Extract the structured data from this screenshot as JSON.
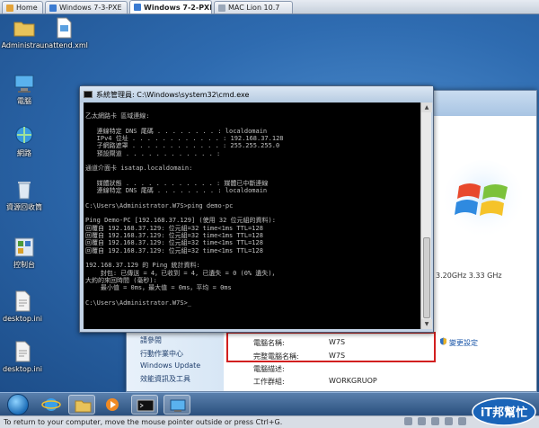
{
  "tabs": [
    {
      "label": "Home",
      "active": false
    },
    {
      "label": "Windows 7-3-PXE",
      "active": false
    },
    {
      "label": "Windows 7-2-PXE",
      "active": true
    },
    {
      "label": "MAC Lion 10.7",
      "active": false
    }
  ],
  "desktop_icons": [
    {
      "label": "Administra...",
      "icon": "folder-icon"
    },
    {
      "label": "unattend.xml",
      "icon": "xml-file-icon"
    },
    {
      "label": "電腦",
      "icon": "computer-icon"
    },
    {
      "label": "網路",
      "icon": "network-icon"
    },
    {
      "label": "資源回收筒",
      "icon": "recycle-bin-icon"
    },
    {
      "label": "控制台",
      "icon": "control-panel-icon"
    },
    {
      "label": "desktop.ini",
      "icon": "ini-file-icon"
    },
    {
      "label": "desktop.ini",
      "icon": "ini-file-icon"
    }
  ],
  "cmd": {
    "title": "系統管理員: C:\\Windows\\system32\\cmd.exe",
    "lines": [
      "",
      "乙太網路卡 區域連線:",
      "",
      "   連線特定 DNS 尾碼 . . . . . . . . : localdomain",
      "   IPv4 位址 . . . . . . . . . . . . : 192.168.37.128",
      "   子網路遮罩 . . . . . . . . . . . . : 255.255.255.0",
      "   預設閘道 . . . . . . . . . . . . :",
      "",
      "通道介面卡 isatap.localdomain:",
      "",
      "   媒體狀態 . . . . . . . . . . . . : 媒體已中斷連線",
      "   連線特定 DNS 尾碼 . . . . . . . . : localdomain",
      "",
      "C:\\Users\\Administrator.W7S>ping demo-pc",
      "",
      "Ping Demo-PC [192.168.37.129] (使用 32 位元組的資料):",
      "回覆自 192.168.37.129: 位元組=32 time<1ms TTL=128",
      "回覆自 192.168.37.129: 位元組=32 time<1ms TTL=128",
      "回覆自 192.168.37.129: 位元組=32 time<1ms TTL=128",
      "回覆自 192.168.37.129: 位元組=32 time<1ms TTL=128",
      "",
      "192.168.37.129 的 Ping 統計資料:",
      "    封包: 已傳送 = 4，已收到 = 4, 已遺失 = 0 (0% 遺失)，",
      "大約的來回時間 (毫秒):",
      "    最小值 = 0ms，最大值 = 0ms，平均 = 0ms",
      "",
      "C:\\Users\\Administrator.W7S>_"
    ]
  },
  "system": {
    "left_nav": [
      "請參閱",
      "行動作業中心",
      "Windows Update",
      "效能資訊及工具"
    ],
    "cpu_speed": "3.20GHz  3.33 GHz",
    "computer_name_label": "電腦名稱:",
    "computer_name_value": "W7S",
    "full_name_label": "完整電腦名稱:",
    "full_name_value": "W7S",
    "description_label": "電腦描述:",
    "workgroup_label": "工作群組:",
    "workgroup_value": "WORKGRUOP",
    "change_settings": "變更設定"
  },
  "statusbar": {
    "text": "To return to your computer, move the mouse pointer outside or press Ctrl+G."
  },
  "watermark": {
    "text": "iT邦幫忙"
  },
  "colors": {
    "cmd_bg": "#000000",
    "cmd_text": "#c0c0c0",
    "highlight_box": "#d21f1f",
    "desktop": "#2e6bb0"
  }
}
